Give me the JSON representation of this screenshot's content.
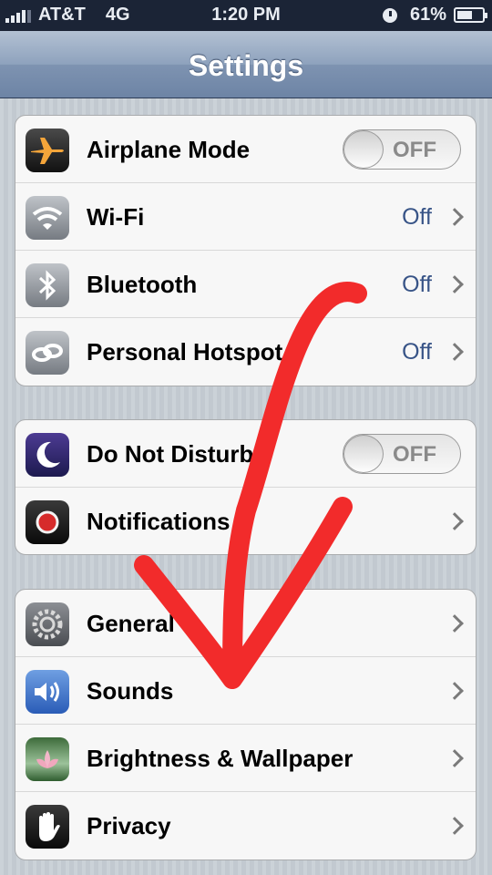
{
  "status_bar": {
    "carrier": "AT&T",
    "network": "4G",
    "time": "1:20 PM",
    "battery": "61%",
    "battery_level": 0.61
  },
  "nav": {
    "title": "Settings"
  },
  "groups": [
    {
      "rows": [
        {
          "label": "Airplane Mode",
          "icon": "airplane-icon",
          "control": "toggle",
          "value": "OFF"
        },
        {
          "label": "Wi-Fi",
          "icon": "wifi-icon",
          "control": "disclosure",
          "value": "Off"
        },
        {
          "label": "Bluetooth",
          "icon": "bluetooth-icon",
          "control": "disclosure",
          "value": "Off"
        },
        {
          "label": "Personal Hotspot",
          "icon": "hotspot-icon",
          "control": "disclosure",
          "value": "Off"
        }
      ]
    },
    {
      "rows": [
        {
          "label": "Do Not Disturb",
          "icon": "moon-icon",
          "control": "toggle",
          "value": "OFF"
        },
        {
          "label": "Notifications",
          "icon": "notifications-icon",
          "control": "disclosure",
          "value": ""
        }
      ]
    },
    {
      "rows": [
        {
          "label": "General",
          "icon": "gear-icon",
          "control": "disclosure",
          "value": ""
        },
        {
          "label": "Sounds",
          "icon": "speaker-icon",
          "control": "disclosure",
          "value": ""
        },
        {
          "label": "Brightness & Wallpaper",
          "icon": "flower-icon",
          "control": "disclosure",
          "value": ""
        },
        {
          "label": "Privacy",
          "icon": "hand-icon",
          "control": "disclosure",
          "value": ""
        }
      ]
    }
  ],
  "overlay": {
    "annotation": "red-arrow-icon",
    "color": "#f22b2b"
  },
  "colors": {
    "value_text": "#385487",
    "nav_bar": "#7e93b1",
    "status_bar": "#1b2436"
  }
}
